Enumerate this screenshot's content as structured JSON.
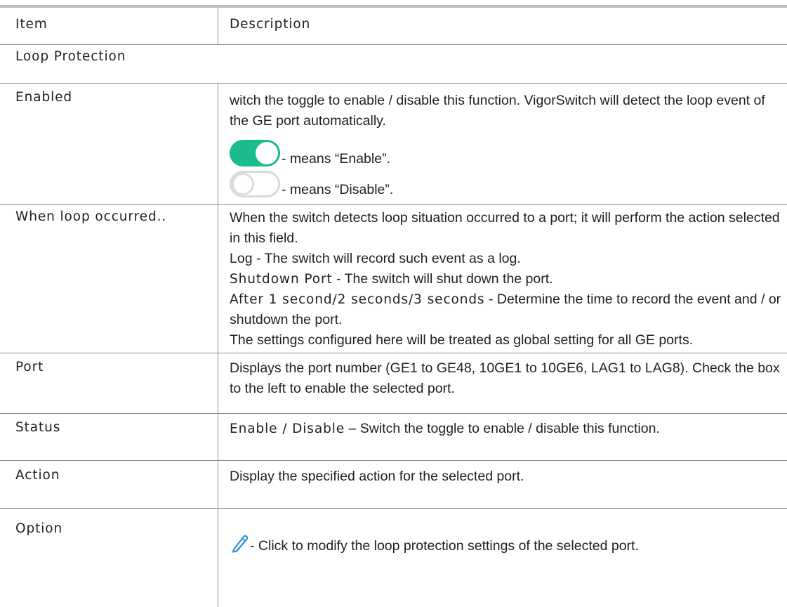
{
  "header": {
    "col1": "Item",
    "col2": "Description"
  },
  "section_title": "Loop Protection",
  "rows": {
    "enabled": {
      "item": "Enabled",
      "desc": "witch the toggle to enable / disable this function. VigorSwitch will detect the loop event of the GE port automatically.",
      "enable_text": "- means “Enable”.",
      "disable_text": "- means “Disable”."
    },
    "loop": {
      "item": "When loop occurred..",
      "line1": "When the switch detects loop situation occurred to a port; it will perform the action selected in this field.",
      "log_label": "Log",
      "log_text": " - The switch will record such event as a log.",
      "shutdown_label": "Shutdown Port",
      "shutdown_text": " - The switch will shut down the port.",
      "after_label": "After 1 second/2 seconds/3 seconds",
      "after_text": " - Determine the time to record the event and / or shutdown the port.",
      "global_text": "The settings configured here will be treated as global setting for all GE ports."
    },
    "port": {
      "item": "Port",
      "desc": "Displays the port number (GE1 to GE48, 10GE1 to 10GE6, LAG1 to LAG8). Check the box to the left to enable the selected port."
    },
    "status": {
      "item": "Status",
      "label": "Enable / Disable",
      "desc": " – Switch the toggle to enable / disable this function."
    },
    "action": {
      "item": "Action",
      "desc": "Display the specified action for the selected port."
    },
    "option": {
      "item": "Option",
      "desc": " - Click to modify the loop protection settings of the selected port.",
      "icon": "pencil-icon"
    }
  },
  "colors": {
    "toggle_on": "#1abc8e",
    "toggle_off_border": "#d9d9d9",
    "pencil": "#2f8fd6"
  }
}
